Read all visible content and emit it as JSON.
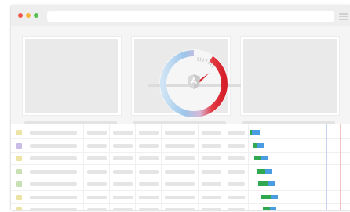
{
  "window": {
    "traffic_lights": [
      "#f2564b",
      "#f8b540",
      "#54c152"
    ]
  },
  "colors": {
    "placeholder": "#eaeaea",
    "gauge_gradient": [
      "#cfe4f5",
      "#9dc6ea",
      "#d7b8d8",
      "#e23b42",
      "#d6202a"
    ],
    "bar_green": "#2fa84f",
    "bar_blue": "#4a9de0"
  },
  "table": {
    "row_swatches": [
      "#ede3a5",
      "#c9bde8",
      "#ede3a5",
      "#c9e0b4",
      "#c9e0b4",
      "#ede3a5",
      "#ede3a5"
    ],
    "waterfall": [
      {
        "green": 2,
        "blue": 10
      },
      {
        "green": 6,
        "blue": 9
      },
      {
        "green": 8,
        "blue": 9
      },
      {
        "green": 11,
        "blue": 8
      },
      {
        "green": 13,
        "blue": 9
      },
      {
        "green": 13,
        "blue": 9
      },
      {
        "green": 9,
        "blue": 8
      }
    ]
  },
  "gauge": {
    "icon": "angular-logo-icon",
    "needle_direction": "upper-right"
  }
}
